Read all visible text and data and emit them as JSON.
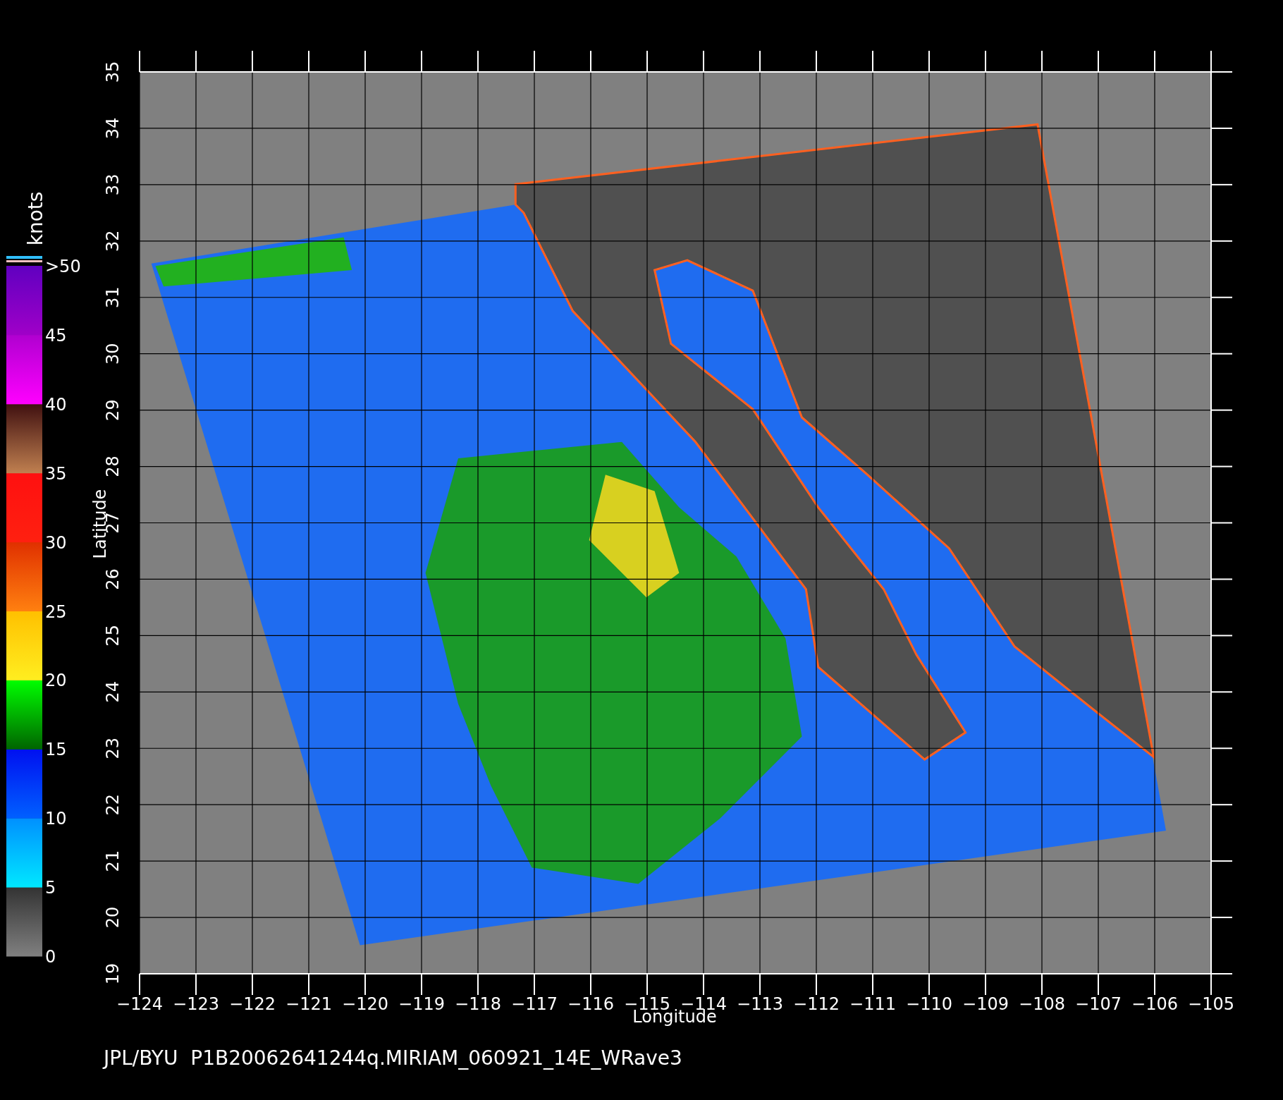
{
  "map": {
    "xlabel": "Longitude",
    "ylabel": "Latitude",
    "x_ticks": [
      "−124",
      "−123",
      "−122",
      "−121",
      "−120",
      "−119",
      "−118",
      "−117",
      "−116",
      "−115",
      "−114",
      "−113",
      "−112",
      "−111",
      "−110",
      "−109",
      "−108",
      "−107",
      "−106",
      "−105"
    ],
    "y_ticks": [
      "19",
      "20",
      "21",
      "22",
      "23",
      "24",
      "25",
      "26",
      "27",
      "28",
      "29",
      "30",
      "31",
      "32",
      "33",
      "34",
      "35"
    ]
  },
  "colorbar": {
    "title": "knots",
    "labels": [
      ">50",
      "45",
      "40",
      "35",
      "30",
      "25",
      "20",
      "15",
      "10",
      "5",
      "0"
    ]
  },
  "footer": "JPL/BYU  P1B20062641244q.MIRIAM_060921_14E_WRave3"
}
